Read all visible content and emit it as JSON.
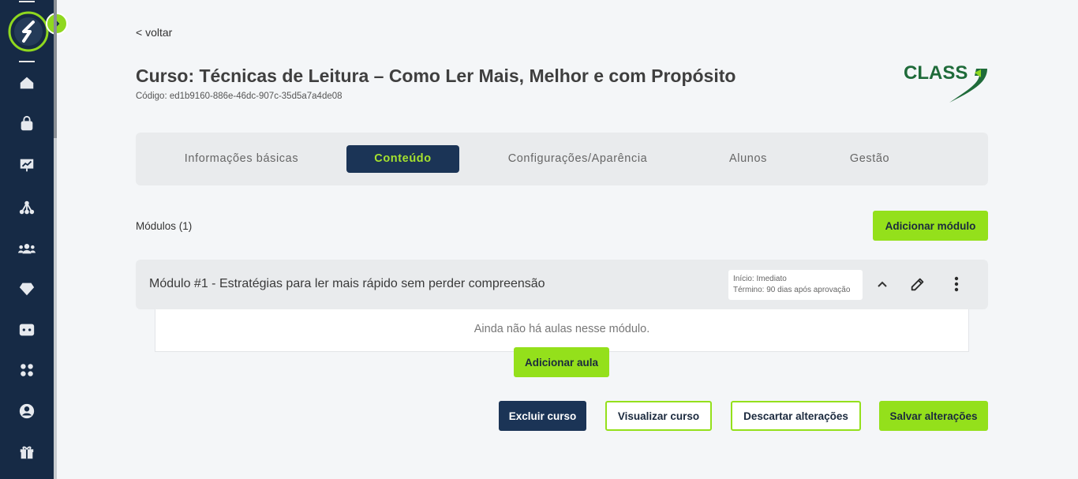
{
  "sidebar": {
    "toggle_icon": "chevron-right-icon",
    "items": [
      {
        "name": "home",
        "icon": "home-icon"
      },
      {
        "name": "bag",
        "icon": "bag-icon"
      },
      {
        "name": "presentation",
        "icon": "presentation-icon"
      },
      {
        "name": "network",
        "icon": "network-icon"
      },
      {
        "name": "users",
        "icon": "users-icon"
      },
      {
        "name": "diamond",
        "icon": "diamond-icon"
      },
      {
        "name": "ticket",
        "icon": "ticket-icon"
      },
      {
        "name": "apps",
        "icon": "apps-icon"
      },
      {
        "name": "profile",
        "icon": "user-circle-icon"
      },
      {
        "name": "gift",
        "icon": "gift-icon"
      }
    ]
  },
  "header": {
    "back_label": "< voltar",
    "title": "Curso: Técnicas de Leitura – Como Ler Mais, Melhor e com Propósito",
    "code": "Código: ed1b9160-886e-46dc-907c-35d5a7a4de08",
    "brand": "CLASS"
  },
  "tabs": [
    {
      "label": "Informações básicas",
      "active": false
    },
    {
      "label": "Conteúdo",
      "active": true
    },
    {
      "label": "Configurações/Aparência",
      "active": false
    },
    {
      "label": "Alunos",
      "active": false
    },
    {
      "label": "Gestão",
      "active": false
    }
  ],
  "modules": {
    "count_label": "Módulos (1)",
    "add_label": "Adicionar módulo",
    "items": [
      {
        "title": "Módulo #1 - Estratégias para ler mais rápido sem perder compreensão",
        "start": "Início: Imediato",
        "end": "Término: 90 dias após aprovação",
        "empty_text": "Ainda não há aulas nesse módulo.",
        "add_lesson_label": "Adicionar aula"
      }
    ]
  },
  "footer": {
    "delete_label": "Excluir curso",
    "view_label": "Visualizar curso",
    "discard_label": "Descartar alterações",
    "save_label": "Salvar alterações"
  },
  "colors": {
    "sidebar": "#162a45",
    "accent": "#94e01b",
    "navy": "#1b3456",
    "brand_green": "#1f6b3a"
  }
}
